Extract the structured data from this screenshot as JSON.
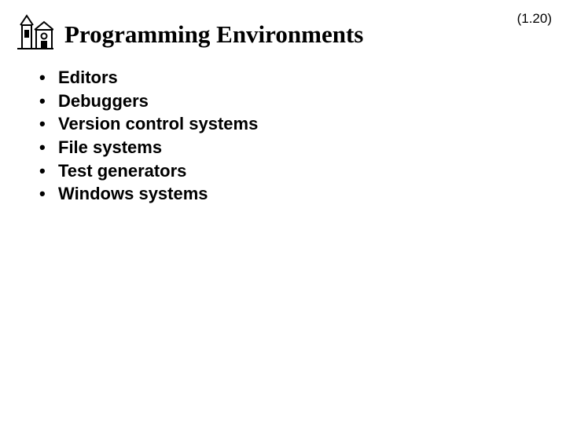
{
  "page_number": "(1.20)",
  "title": "Programming Environments",
  "bullets": {
    "0": "Editors",
    "1": "Debuggers",
    "2": "Version control systems",
    "3": "File systems",
    "4": "Test generators",
    "5": "Windows systems"
  }
}
